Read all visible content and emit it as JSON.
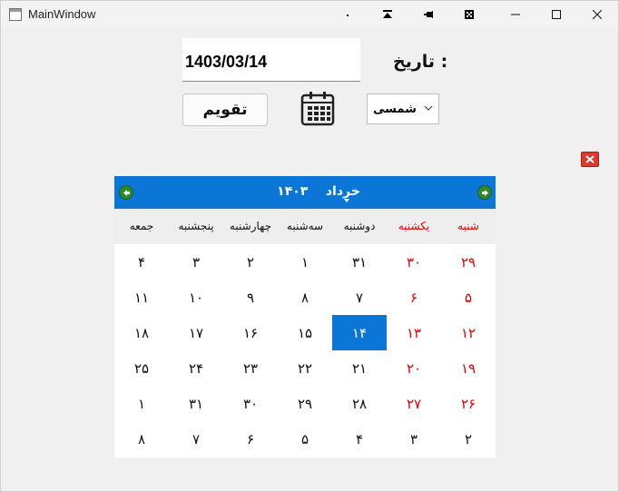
{
  "window": {
    "title": "MainWindow",
    "controls": [
      "minimize-icon",
      "maximize-icon",
      "close-icon"
    ],
    "tool_icons": [
      "dot-icon",
      "stack-up-icon",
      "pin-icon",
      "grid-icon"
    ]
  },
  "form": {
    "date_label": "تاریخ :",
    "date_value": "1403/03/14",
    "calendar_button": "تقویم",
    "calendar_type_selected": "شمسی"
  },
  "calendar": {
    "month_name": "خرداد",
    "year": "۱۴۰۳",
    "weekdays": [
      "شنبه",
      "یکشنبه",
      "دوشنبه",
      "سه‌شنبه",
      "چهارشنبه",
      "پنجشنبه",
      "جمعه"
    ],
    "weeks": [
      [
        "۲۹",
        "۳۰",
        "۳۱",
        "۱",
        "۲",
        "۳",
        "۴"
      ],
      [
        "۵",
        "۶",
        "۷",
        "۸",
        "۹",
        "۱۰",
        "۱۱"
      ],
      [
        "۱۲",
        "۱۳",
        "۱۴",
        "۱۵",
        "۱۶",
        "۱۷",
        "۱۸"
      ],
      [
        "۱۹",
        "۲۰",
        "۲۱",
        "۲۲",
        "۲۳",
        "۲۴",
        "۲۵"
      ],
      [
        "۲۶",
        "۲۷",
        "۲۸",
        "۲۹",
        "۳۰",
        "۳۱",
        "۱"
      ],
      [
        "۲",
        "۳",
        "۴",
        "۵",
        "۶",
        "۷",
        "۸"
      ]
    ],
    "selected": "۱۴",
    "colors": {
      "header": "#0b76d6",
      "holiday": "#e00000",
      "selected_bg": "#0b76d6"
    }
  }
}
